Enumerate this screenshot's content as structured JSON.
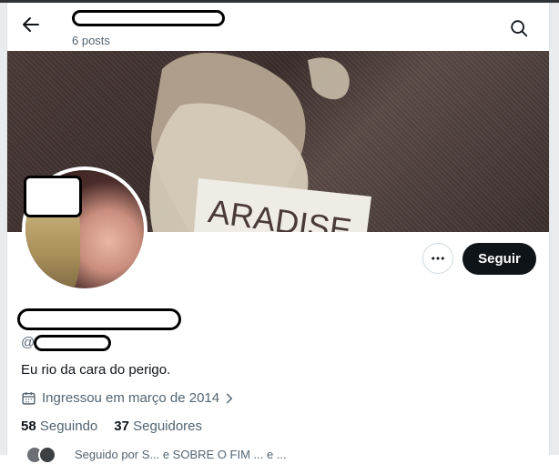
{
  "header": {
    "posts_count": "6 posts"
  },
  "profile": {
    "handle_prefix": "@",
    "bio": "Eu rio da cara do perigo.",
    "joined": "Ingressou em março de 2014",
    "following_count": "58",
    "following_label": "Seguindo",
    "followers_count": "37",
    "followers_label": "Seguidores"
  },
  "actions": {
    "follow_label": "Seguir"
  },
  "preview": {
    "text": "Seguido por S... e SOBRE O FIM ... e ... "
  },
  "icons": {
    "back": "arrow-left-icon",
    "search": "search-icon",
    "more": "more-horizontal-icon",
    "calendar": "calendar-icon",
    "chevron": "chevron-right-icon"
  },
  "colors": {
    "follow_button_bg": "#0f1419",
    "secondary_text": "#536471"
  }
}
